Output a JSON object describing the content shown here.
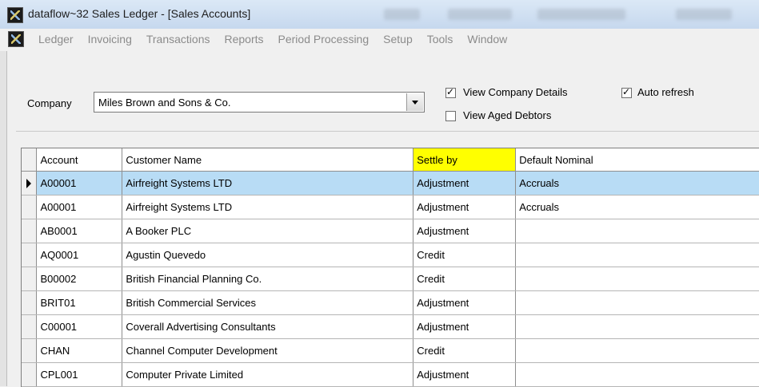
{
  "window": {
    "title": "dataflow~32 Sales Ledger - [Sales Accounts]"
  },
  "menu": {
    "items": [
      "Ledger",
      "Invoicing",
      "Transactions",
      "Reports",
      "Period Processing",
      "Setup",
      "Tools",
      "Window"
    ]
  },
  "filters": {
    "company_label": "Company",
    "company_value": "Miles Brown and Sons & Co.",
    "view_company_details": {
      "label": "View Company Details",
      "checked": true
    },
    "auto_refresh": {
      "label": "Auto refresh",
      "checked": true
    },
    "view_aged_debtors": {
      "label": "View Aged Debtors",
      "checked": false
    }
  },
  "grid": {
    "columns": [
      "Account",
      "Customer Name",
      "Settle by",
      "Default Nominal"
    ],
    "highlighted_column": "Settle by",
    "selected_row": 0,
    "rows": [
      [
        "A00001",
        "Airfreight Systems LTD",
        "Adjustment",
        "Accruals"
      ],
      [
        "A00001",
        "Airfreight Systems LTD",
        "Adjustment",
        "Accruals"
      ],
      [
        "AB0001",
        "A Booker PLC",
        "Adjustment",
        ""
      ],
      [
        "AQ0001",
        "Agustin Quevedo",
        "Credit",
        ""
      ],
      [
        "B00002",
        "British Financial Planning Co.",
        "Credit",
        ""
      ],
      [
        "BRIT01",
        "British Commercial Services",
        "Adjustment",
        ""
      ],
      [
        "C00001",
        "Coverall Advertising Consultants",
        "Adjustment",
        ""
      ],
      [
        "CHAN",
        "Channel Computer Development",
        "Credit",
        ""
      ],
      [
        "CPL001",
        "Computer Private Limited",
        "Adjustment",
        ""
      ]
    ]
  },
  "colors": {
    "selected_row": "#b8dcf5",
    "highlight_header": "#ffff00"
  },
  "icons": {
    "app": "dataflow-app-icon",
    "current_row": "row-pointer-icon"
  }
}
